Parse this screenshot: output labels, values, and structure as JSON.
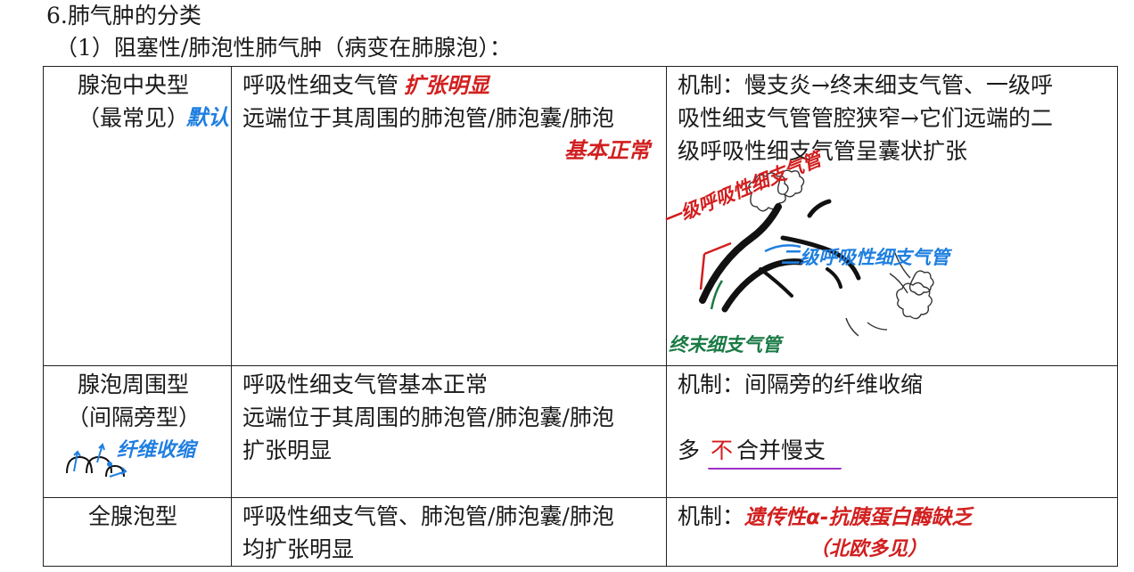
{
  "heading": "6.肺气肿的分类",
  "subheading": "（1）阻塞性/肺泡性肺气肿（病变在肺腺泡）：",
  "rows": [
    {
      "type_name": "腺泡中央型",
      "type_sub": "（最常见）",
      "type_note": "默认",
      "desc_line1_a": "呼吸性细支气管",
      "desc_line1_b": "扩张明显",
      "desc_line2": "远端位于其周围的肺泡管/肺泡囊/肺泡",
      "desc_line3": "基本正常",
      "mech_line1": "机制：慢支炎→终末细支气管、一级呼",
      "mech_line2": "吸性细支气管管腔狭窄→它们远端的二",
      "mech_line3": "级呼吸性细支气管呈囊状扩张",
      "diagram": {
        "label_first": "一级呼吸性细支气管",
        "label_second": "二级呼吸性细支气管",
        "label_terminal": "终末细支气管"
      }
    },
    {
      "type_name": "腺泡周围型",
      "type_sub": "（间隔旁型）",
      "type_note": "纤维收缩",
      "desc_line1": "呼吸性细支气管基本正常",
      "desc_line2": "远端位于其周围的肺泡管/肺泡囊/肺泡",
      "desc_line3": "扩张明显",
      "mech_line1": "机制：间隔旁的纤维收缩",
      "mech_line2_a": "多",
      "mech_line2_b": "不",
      "mech_line2_c": "合并慢支"
    },
    {
      "type_name": "全腺泡型",
      "desc_line1": "呼吸性细支气管、肺泡管/肺泡囊/肺泡",
      "desc_line2": "均扩张明显",
      "mech_label": "机制：",
      "mech_note": "遗传性α-抗胰蛋白酶缺乏",
      "mech_note2": "（北欧多见）"
    }
  ],
  "colors": {
    "red_annotation": "#d21f1f",
    "blue_annotation": "#1f7fe0",
    "green_annotation": "#1a7a45",
    "purple_underline": "#9b30c8"
  }
}
